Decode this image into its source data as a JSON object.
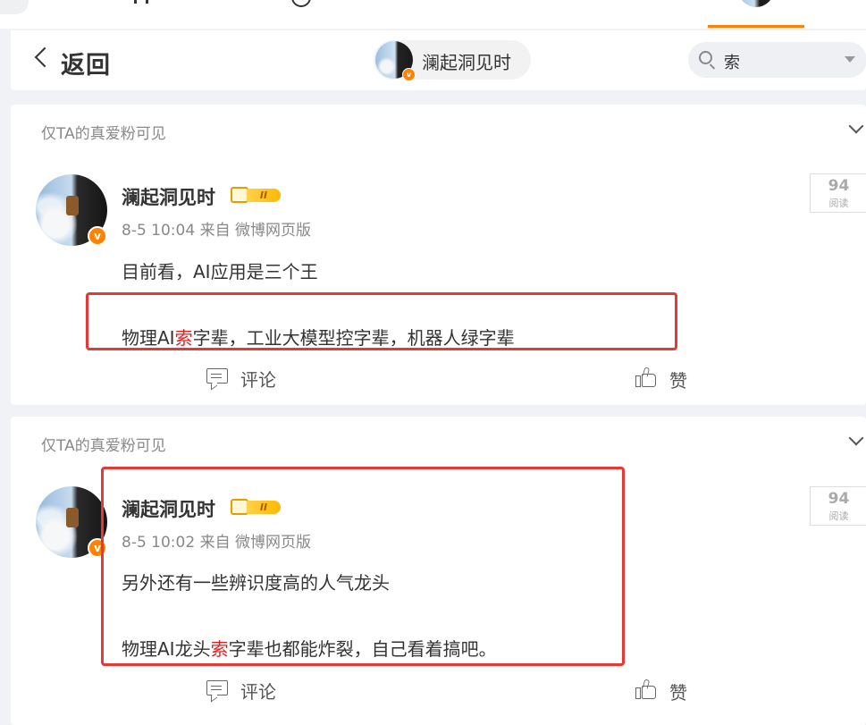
{
  "nav": {
    "back_label": "返回",
    "user_chip_name": "澜起洞见时",
    "search_value": "索"
  },
  "colors": {
    "accent": "#ff8200",
    "highlight": "#e02020",
    "annotation": "#e53935"
  },
  "posts": [
    {
      "visibility": "仅TA的真爱粉可见",
      "author": "澜起洞见时",
      "vip_level": "II",
      "verified_mark": "v",
      "meta": "8-5 10:04  来自 微博网页版",
      "read_count": "94",
      "read_label": "阅读",
      "line1": "目前看，AI应用是三个王",
      "line2_pre": "物理AI",
      "line2_hl": "索",
      "line2_post": "字辈，工业大模型控字辈，机器人绿字辈",
      "comment_label": "评论",
      "like_label": "赞"
    },
    {
      "visibility": "仅TA的真爱粉可见",
      "author": "澜起洞见时",
      "vip_level": "II",
      "verified_mark": "v",
      "meta": "8-5 10:02  来自 微博网页版",
      "read_count": "94",
      "read_label": "阅读",
      "line1": "另外还有一些辨识度高的人气龙头",
      "line2_pre": "物理AI龙头",
      "line2_hl": "索",
      "line2_post": "字辈也都能炸裂，自己看着搞吧。",
      "comment_label": "评论",
      "like_label": "赞"
    }
  ]
}
